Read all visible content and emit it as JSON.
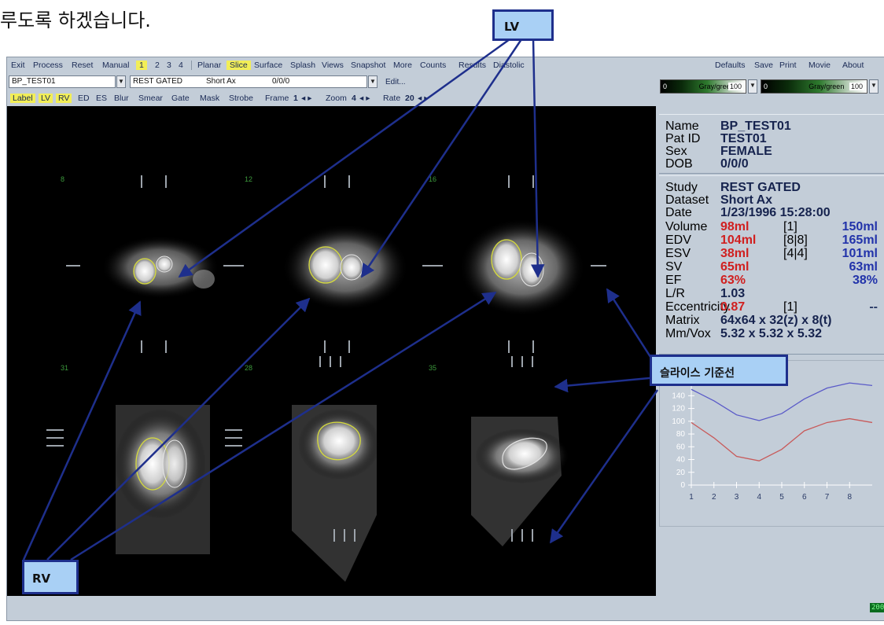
{
  "caption": "루도록 하겠습니다.",
  "menu": [
    "Exit",
    "Process",
    "Reset",
    "Manual",
    "1",
    "2",
    "3",
    "4",
    "Planar",
    "Slice",
    "Surface",
    "Splash",
    "Views",
    "Snapshot",
    "More",
    "Counts",
    "Results",
    "Diastolic"
  ],
  "menu_right": [
    "Defaults",
    "Save",
    "Print",
    "Movie",
    "About"
  ],
  "patient_select": "BP_TEST01",
  "study_select": "REST GATED",
  "dataset_label": "Short Ax",
  "gate_label": "0/0/0",
  "edit_label": "Edit...",
  "toolbar": {
    "buttons": [
      "Label",
      "LV",
      "RV",
      "ED",
      "ES",
      "Blur",
      "Smear",
      "Gate",
      "Mask",
      "Strobe"
    ],
    "frame_label": "Frame",
    "frame_value": "1",
    "zoom_label": "Zoom",
    "zoom_value": "4",
    "rate_label": "Rate",
    "rate_value": "20",
    "arrows": "◂ ▸"
  },
  "colorbars": [
    {
      "low": "0",
      "name": "Gray/green",
      "high": "100"
    },
    {
      "low": "0",
      "name": "Gray/green",
      "high": "100"
    }
  ],
  "slices": [
    "8",
    "12",
    "16",
    "31",
    "28",
    "35"
  ],
  "patient": {
    "name_label": "Name",
    "name": "BP_TEST01",
    "patid_label": "Pat ID",
    "patid": "TEST01",
    "sex_label": "Sex",
    "sex": "FEMALE",
    "dob_label": "DOB",
    "dob": "0/0/0"
  },
  "study_info": {
    "study_label": "Study",
    "study": "REST GATED",
    "dataset_label": "Dataset",
    "dataset": "Short Ax",
    "date_label": "Date",
    "date": "1/23/1996 15:28:00",
    "volume_label": "Volume",
    "volume": "98ml",
    "volume_frame": "[1]",
    "volume_rv": "150ml",
    "edv_label": "EDV",
    "edv": "104ml",
    "edv_frame": "[8|8]",
    "edv_rv": "165ml",
    "esv_label": "ESV",
    "esv": "38ml",
    "esv_frame": "[4|4]",
    "esv_rv": "101ml",
    "sv_label": "SV",
    "sv": "65ml",
    "sv_rv": "63ml",
    "ef_label": "EF",
    "ef": "63%",
    "ef_rv": "38%",
    "lr_label": "L/R",
    "lr": "1.03",
    "ecc_label": "Eccentricity",
    "ecc": "0.87",
    "ecc_frame": "[1]",
    "ecc_rv": "--",
    "matrix_label": "Matrix",
    "matrix": "64x64 x 32(z) x 8(t)",
    "mmvox_label": "Mm/Vox",
    "mmvox": "5.32 x 5.32 x 5.32"
  },
  "curve_colors": {
    "rv": "#5a5ac8",
    "lv": "#c85a5a"
  },
  "chart_data": {
    "type": "line",
    "x": [
      1,
      2,
      3,
      4,
      5,
      6,
      7,
      8,
      9
    ],
    "series": [
      {
        "values": [
          150,
          132,
          110,
          101,
          112,
          135,
          152,
          160,
          156
        ]
      },
      {
        "values": [
          98,
          74,
          45,
          38,
          56,
          85,
          98,
          104,
          98
        ]
      }
    ],
    "xticks": [
      "1",
      "2",
      "3",
      "4",
      "5",
      "6",
      "7",
      "8"
    ],
    "yticks": [
      "0",
      "20",
      "40",
      "60",
      "80",
      "100",
      "120",
      "140"
    ],
    "ylim": [
      0,
      170
    ],
    "xlim": [
      1,
      9
    ]
  },
  "status_text": "200",
  "callouts": {
    "lv": "LV",
    "rv": "RV",
    "slice_ref": "슬라이스 기준선"
  }
}
